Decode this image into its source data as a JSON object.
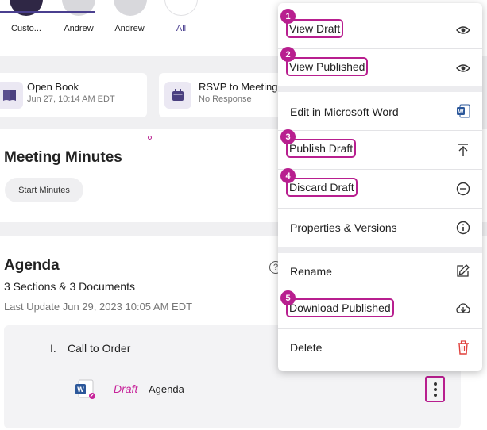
{
  "attendees": [
    {
      "label": "Custo..."
    },
    {
      "label": "Andrew"
    },
    {
      "label": "Andrew"
    },
    {
      "label": "All"
    }
  ],
  "cards": {
    "open_book": {
      "title": "Open Book",
      "sub": "Jun 27, 10:14 AM EDT"
    },
    "rsvp": {
      "title": "RSVP to Meeting",
      "sub": "No Response"
    }
  },
  "minutes": {
    "title": "Meeting Minutes",
    "start_label": "Start Minutes"
  },
  "agenda": {
    "title": "Agenda",
    "summary": "3 Sections & 3 Documents",
    "last_update": "Last Update Jun 29, 2023 10:05 AM EDT",
    "help_glyph": "?",
    "section_number": "I.",
    "section_name": "Call to Order",
    "document_status": "Draft",
    "document_name": "Agenda"
  },
  "menu": {
    "items": [
      {
        "label": "View Draft",
        "badge": "1",
        "icon": "eye-icon"
      },
      {
        "label": "View Published",
        "badge": "2",
        "icon": "eye-icon"
      },
      {
        "label": "Edit in Microsoft Word",
        "icon": "word-icon"
      },
      {
        "label": "Publish Draft",
        "badge": "3",
        "icon": "upload-arrow-icon"
      },
      {
        "label": "Discard Draft",
        "badge": "4",
        "icon": "minus-circle-icon"
      },
      {
        "label": "Properties & Versions",
        "icon": "info-circle-icon"
      },
      {
        "label": "Rename",
        "icon": "edit-icon"
      },
      {
        "label": "Download Published",
        "badge": "5",
        "icon": "cloud-download-icon"
      },
      {
        "label": "Delete",
        "icon": "trash-icon"
      }
    ]
  },
  "colors": {
    "highlight": "#b81f8f",
    "accent": "#4a3f8f",
    "draft": "#c7249a",
    "delete": "#e0403c",
    "word": "#2b579a"
  }
}
